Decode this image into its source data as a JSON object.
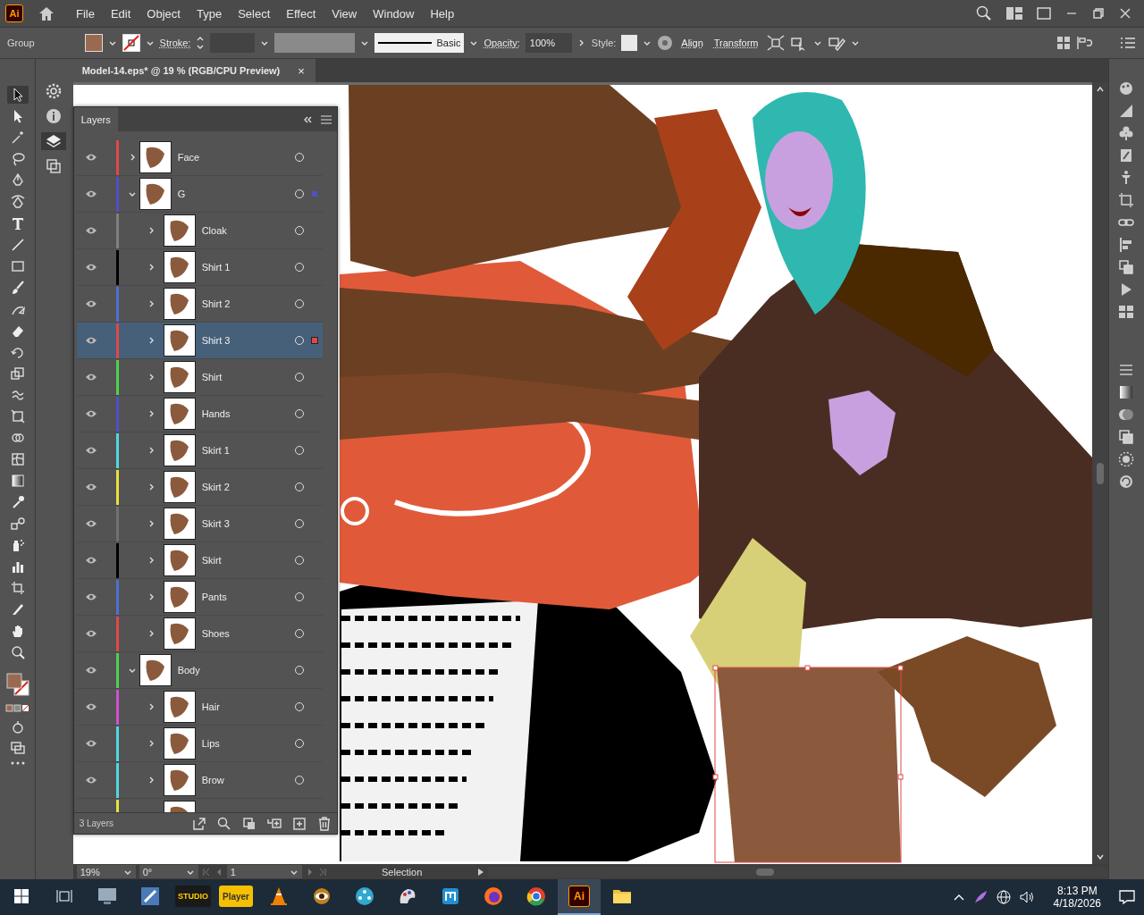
{
  "app": {
    "logo": "Ai",
    "menus": [
      "File",
      "Edit",
      "Object",
      "Type",
      "Select",
      "Effect",
      "View",
      "Window",
      "Help"
    ]
  },
  "control_bar": {
    "selection": "Group",
    "stroke_label": "Stroke:",
    "brush": "Basic",
    "opacity_label": "Opacity:",
    "opacity": "100%",
    "style_label": "Style:",
    "links": [
      "Align",
      "Transform"
    ]
  },
  "document_tab": {
    "title": "Model-14.eps* @ 19 % (RGB/CPU Preview)",
    "close": "×"
  },
  "tools": [
    {
      "kind": "selection",
      "selected": true
    },
    {
      "kind": "direct",
      "selected": false
    },
    {
      "kind": "wand",
      "selected": false
    },
    {
      "kind": "lasso",
      "selected": false
    },
    {
      "kind": "pen",
      "selected": false
    },
    {
      "kind": "curvature",
      "selected": false
    },
    {
      "kind": "type",
      "selected": false
    },
    {
      "kind": "line",
      "selected": false
    },
    {
      "kind": "rectangle",
      "selected": false
    },
    {
      "kind": "brush",
      "selected": false
    },
    {
      "kind": "pencil",
      "selected": false
    },
    {
      "kind": "eraser",
      "selected": false
    },
    {
      "kind": "rotate",
      "selected": false
    },
    {
      "kind": "scale",
      "selected": false
    },
    {
      "kind": "warp",
      "selected": false
    },
    {
      "kind": "transform",
      "selected": false
    },
    {
      "kind": "builder",
      "selected": false
    },
    {
      "kind": "mesh",
      "selected": false
    },
    {
      "kind": "gradient",
      "selected": false
    },
    {
      "kind": "eyedropper",
      "selected": false
    },
    {
      "kind": "blend",
      "selected": false
    },
    {
      "kind": "sprayer",
      "selected": false
    },
    {
      "kind": "graph",
      "selected": false
    },
    {
      "kind": "artboard",
      "selected": false
    },
    {
      "kind": "slice",
      "selected": false
    },
    {
      "kind": "hand",
      "selected": false
    },
    {
      "kind": "zoom",
      "selected": false
    }
  ],
  "side_panels": [
    {
      "kind": "gear",
      "selected": false
    },
    {
      "kind": "info",
      "selected": false
    },
    {
      "kind": "layers",
      "selected": true
    },
    {
      "kind": "artboards",
      "selected": false
    }
  ],
  "layers_panel": {
    "title": "Layers",
    "layers": [
      {
        "name": "Face",
        "color": "#e04848",
        "visible": true,
        "expanded": false,
        "selected": false,
        "marked": false
      },
      {
        "name": "G",
        "color": "#5050c8",
        "visible": true,
        "expanded": true,
        "selected": false,
        "marked": true,
        "children": [
          {
            "name": "Cloak",
            "color": "#808080",
            "visible": true,
            "expanded": false,
            "selected": false,
            "marked": false
          },
          {
            "name": "Shirt 1",
            "color": "#000000",
            "visible": true,
            "expanded": false,
            "selected": false,
            "marked": false
          },
          {
            "name": "Shirt 2",
            "color": "#5070d0",
            "visible": true,
            "expanded": false,
            "selected": false,
            "marked": false
          },
          {
            "name": "Shirt 3",
            "color": "#e04848",
            "visible": true,
            "expanded": false,
            "selected": true,
            "marked": true
          },
          {
            "name": "Shirt",
            "color": "#50d050",
            "visible": true,
            "expanded": false,
            "selected": false,
            "marked": false
          },
          {
            "name": "Hands",
            "color": "#5050c8",
            "visible": true,
            "expanded": false,
            "selected": false,
            "marked": false
          },
          {
            "name": "Skirt 1",
            "color": "#50d8e0",
            "visible": true,
            "expanded": false,
            "selected": false,
            "marked": false
          },
          {
            "name": "Skirt 2",
            "color": "#e8e040",
            "visible": true,
            "expanded": false,
            "selected": false,
            "marked": false
          },
          {
            "name": "Skirt 3",
            "color": "#707070",
            "visible": true,
            "expanded": false,
            "selected": false,
            "marked": false
          },
          {
            "name": "Skirt",
            "color": "#000000",
            "visible": true,
            "expanded": false,
            "selected": false,
            "marked": false
          },
          {
            "name": "Pants",
            "color": "#5070d0",
            "visible": true,
            "expanded": false,
            "selected": false,
            "marked": false
          },
          {
            "name": "Shoes",
            "color": "#e04848",
            "visible": true,
            "expanded": false,
            "selected": false,
            "marked": false
          }
        ]
      },
      {
        "name": "Body",
        "color": "#50d050",
        "visible": true,
        "expanded": true,
        "selected": false,
        "marked": false,
        "children": [
          {
            "name": "Hair",
            "color": "#d050d0",
            "visible": true,
            "expanded": false,
            "selected": false,
            "marked": false
          },
          {
            "name": "Lips",
            "color": "#50d8e0",
            "visible": true,
            "expanded": false,
            "selected": false,
            "marked": false
          },
          {
            "name": "Brow",
            "color": "#50d8e0",
            "visible": true,
            "expanded": false,
            "selected": false,
            "marked": false
          },
          {
            "color": "#e8e040",
            "selected": false
          }
        ]
      }
    ],
    "count": "3 Layers"
  },
  "status_bar": {
    "zoom": "19%",
    "rotation": "0°",
    "artboard": "1",
    "tool": "Selection"
  },
  "taskbar": {
    "apps": [
      {
        "kind": "monitor",
        "active": false
      },
      {
        "kind": "paint",
        "active": false
      },
      {
        "kind": "studio",
        "label": "STUDIO",
        "active": false
      },
      {
        "kind": "player",
        "label": "Player",
        "active": false
      },
      {
        "kind": "cone",
        "active": false
      },
      {
        "kind": "eye",
        "active": false
      },
      {
        "kind": "film",
        "active": false
      },
      {
        "kind": "palette",
        "active": false
      },
      {
        "kind": "mx",
        "active": false
      },
      {
        "kind": "firefox",
        "active": false
      },
      {
        "kind": "chrome",
        "active": false
      },
      {
        "kind": "illustrator",
        "label": "Ai",
        "active": true
      },
      {
        "kind": "folder",
        "active": false
      }
    ],
    "time": "8:13 PM",
    "date": "4/18/2026"
  }
}
